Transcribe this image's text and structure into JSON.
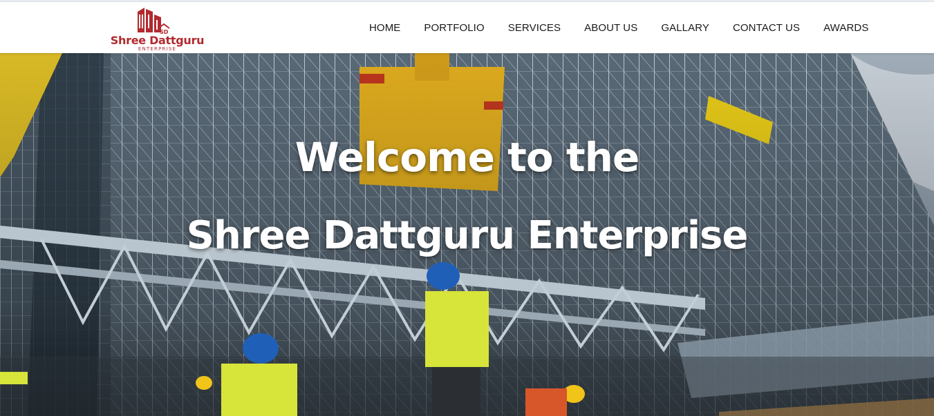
{
  "brand": {
    "name": "Shree Dattguru",
    "subtitle": "ENTERPRISE",
    "mark_initials": "SD",
    "color": "#b22a2f"
  },
  "nav": {
    "items": [
      "HOME",
      "PORTFOLIO",
      "SERVICES",
      "ABOUT US",
      "GALLARY",
      "CONTACT US",
      "AWARDS"
    ]
  },
  "hero": {
    "line1": "Welcome to the",
    "line2": "Shree Dattguru Enterprise",
    "image": "construction-site-steel-frame-with-workers-and-crane",
    "overlay_text_color": "#ffffff",
    "accent_crane_color": "#e8b320",
    "vest_color": "#d7e43a",
    "helmet_color": "#1f5fb8"
  }
}
